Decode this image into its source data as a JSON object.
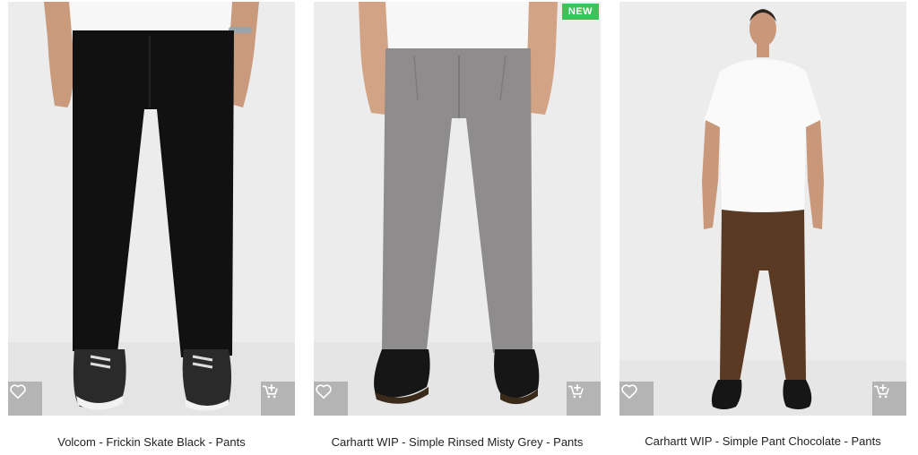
{
  "products": [
    {
      "title": "Volcom - Frickin Skate Black - Pants",
      "badge": "",
      "pant_color": "#111111",
      "wishlist_icon": "heart-icon",
      "cart_icon": "cart-add-icon"
    },
    {
      "title": "Carhartt WIP - Simple Rinsed Misty Grey - Pants",
      "badge": "NEW",
      "pant_color": "#8e8c8c",
      "wishlist_icon": "heart-icon",
      "cart_icon": "cart-add-icon"
    },
    {
      "title": "Carhartt WIP - Simple Pant Chocolate - Pants",
      "badge": "",
      "pant_color": "#5a3a22",
      "wishlist_icon": "heart-icon",
      "cart_icon": "cart-add-icon"
    }
  ],
  "colors": {
    "badge_new": "#3cc35a",
    "action_button_bg": "#b4b4b4",
    "photo_bg": "#ececec"
  }
}
